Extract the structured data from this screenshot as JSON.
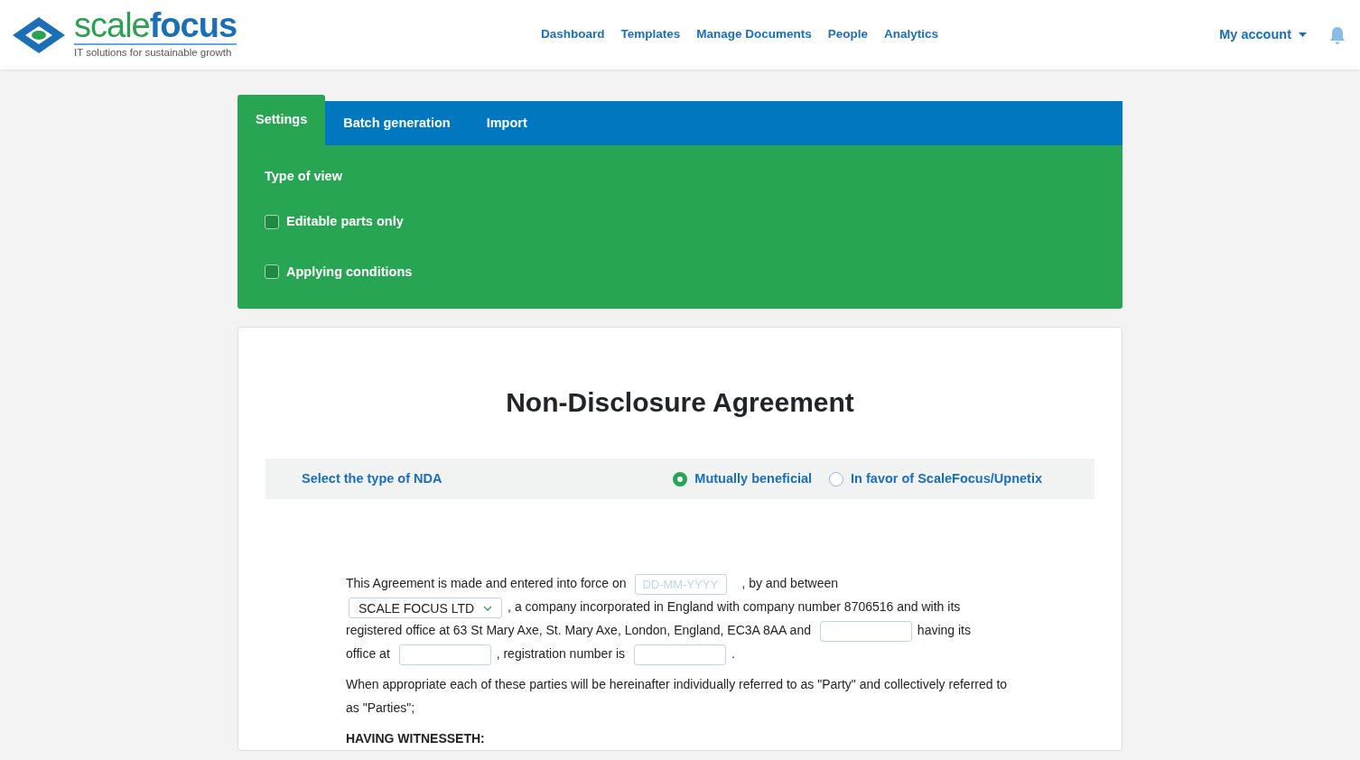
{
  "logo": {
    "name": "scale",
    "name_bold": "focus",
    "tagline": "IT solutions for sustainable growth"
  },
  "nav": [
    {
      "label": "Dashboard"
    },
    {
      "label": "Templates"
    },
    {
      "label": "Manage Documents"
    },
    {
      "label": "People"
    },
    {
      "label": "Analytics"
    }
  ],
  "account": {
    "label": "My account"
  },
  "tabs": [
    {
      "label": "Settings",
      "selected": true
    },
    {
      "label": "Batch generation",
      "selected": false
    },
    {
      "label": "Import",
      "selected": false
    }
  ],
  "settings": {
    "heading": "Type of view",
    "options": [
      {
        "label": "Editable parts only",
        "checked": false
      },
      {
        "label": "Applying conditions",
        "checked": false
      }
    ]
  },
  "document": {
    "title": "Non-Disclosure Agreement",
    "nda_type": {
      "label": "Select the type of NDA",
      "options": [
        {
          "label": "Mutually beneficial",
          "selected": true
        },
        {
          "label": "In favor of ScaleFocus/Upnetix",
          "selected": false
        }
      ]
    },
    "paragraph": [
      {
        "kind": "text",
        "text": "This Agreement is made and entered into force on"
      },
      {
        "kind": "date",
        "placeholder": "DD-MM-YYYY"
      },
      {
        "kind": "text",
        "text": ", by and between"
      },
      {
        "kind": "break"
      },
      {
        "kind": "select",
        "value": "SCALE FOCUS LTD"
      },
      {
        "kind": "text",
        "text": ", a company incorporated in England with company number 8706516 and with its"
      },
      {
        "kind": "break"
      },
      {
        "kind": "text",
        "text": "registered office at 63 St Mary Axe, St. Mary Axe, London, England, EC3A 8AA"
      },
      {
        "kind": "text",
        "text": "and"
      },
      {
        "kind": "input"
      },
      {
        "kind": "text",
        "text": "having its"
      },
      {
        "kind": "break"
      },
      {
        "kind": "text",
        "text": "office at"
      },
      {
        "kind": "input"
      },
      {
        "kind": "text",
        "text": ", registration number is"
      },
      {
        "kind": "input"
      },
      {
        "kind": "text",
        "text": "."
      }
    ],
    "parties_text": "When appropriate each of these parties will be hereinafter individually referred to as \"Party\" and collectively referred to as \"Parties\";",
    "witness": "HAVING WITNESSETH:"
  }
}
